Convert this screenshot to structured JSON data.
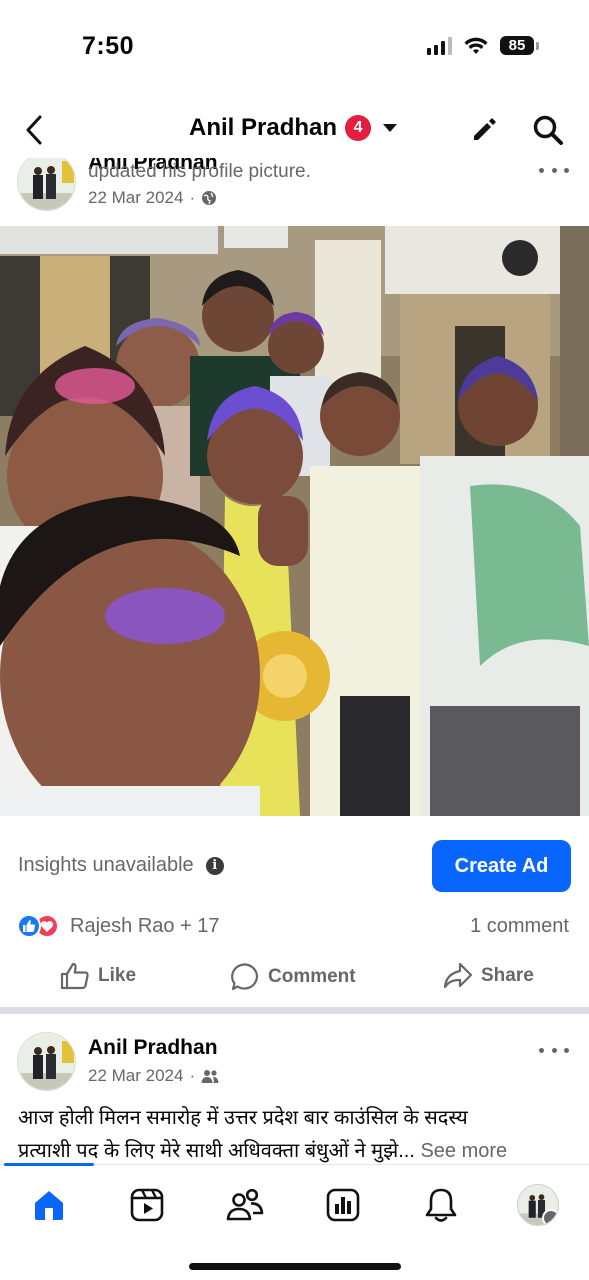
{
  "status": {
    "time": "7:50",
    "battery": "85"
  },
  "header": {
    "title": "Anil Pradhan",
    "badge": "4"
  },
  "post1": {
    "author": "Anil Pradhan",
    "action": " updated his profile picture.",
    "date": "22 Mar 2024",
    "audience_icon": "globe-icon"
  },
  "insights": {
    "label": "Insights unavailable",
    "cta": "Create Ad"
  },
  "reactions": {
    "types": [
      "like",
      "love"
    ],
    "names": "Rajesh Rao + 17",
    "comments": "1 comment"
  },
  "actions": {
    "like": "Like",
    "comment": "Comment",
    "share": "Share"
  },
  "post2": {
    "author": "Anil Pradhan",
    "date": "22 Mar 2024",
    "audience_icon": "friends-icon",
    "line1": "आज होली मिलन समारोह में उत्तर प्रदेश बार काउंसिल के सदस्य",
    "line2": "प्रत्याशी पद के लिए मेरे साथी अधिवक्ता बंधुओं ने मुझे... ",
    "see_more": "See more"
  },
  "colors": {
    "accent": "#0866ff",
    "badge": "#e41e3f",
    "secondary_text": "#65676b"
  }
}
